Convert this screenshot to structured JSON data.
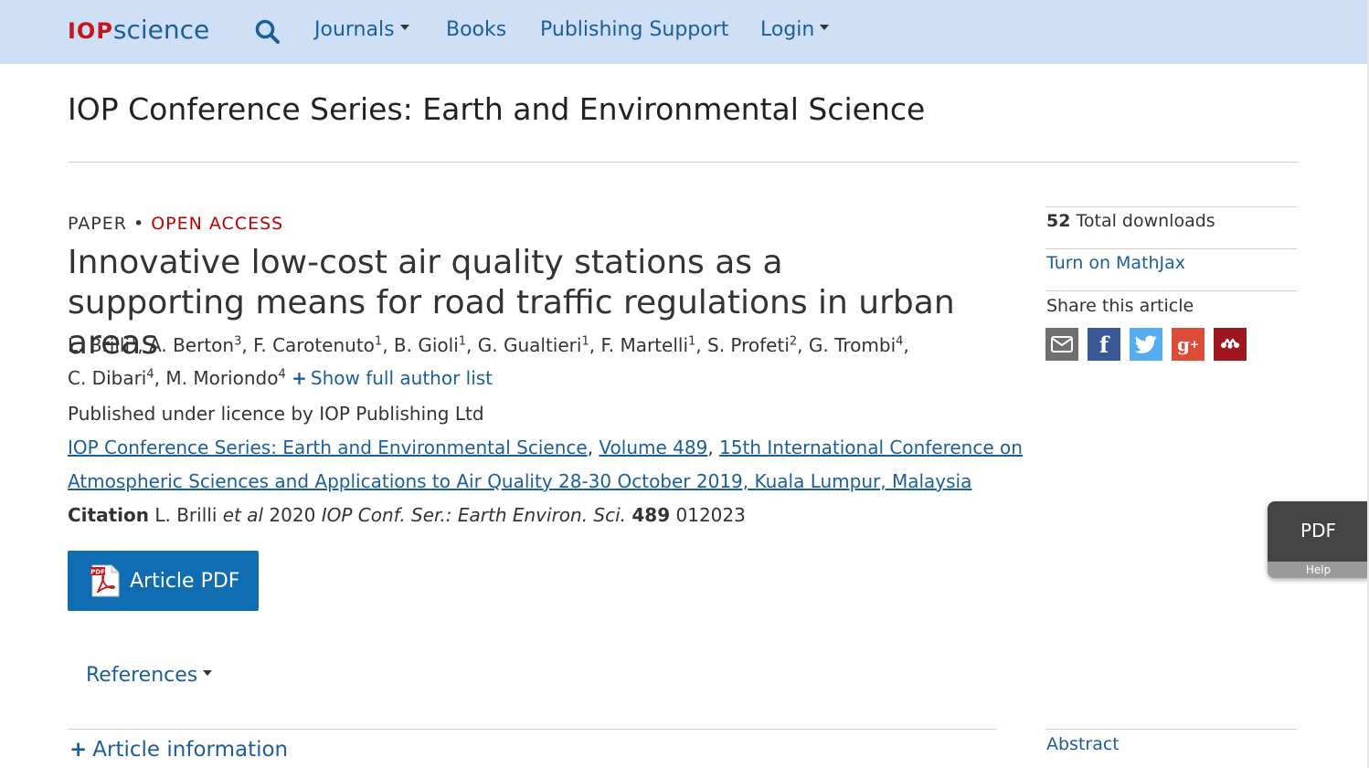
{
  "nav": {
    "logo_iop": "IOP",
    "logo_science": "science",
    "items": [
      {
        "label": "Journals",
        "dropdown": true
      },
      {
        "label": "Books",
        "dropdown": false
      },
      {
        "label": "Publishing Support",
        "dropdown": false
      },
      {
        "label": "Login",
        "dropdown": true
      }
    ],
    "search_icon": "search-icon"
  },
  "journal_title": "IOP Conference Series: Earth and Environmental Science",
  "article": {
    "type": "PAPER",
    "separator": "•",
    "access": "OPEN ACCESS",
    "title": "Innovative low-cost air quality stations as a supporting means for road traffic regulations in urban areas",
    "authors": [
      {
        "name": "L. Brilli",
        "aff": "1"
      },
      {
        "name": "A. Berton",
        "aff": "3"
      },
      {
        "name": "F. Carotenuto",
        "aff": "1"
      },
      {
        "name": "B. Gioli",
        "aff": "1"
      },
      {
        "name": "G. Gualtieri",
        "aff": "1"
      },
      {
        "name": "F. Martelli",
        "aff": "1"
      },
      {
        "name": "S. Profeti",
        "aff": "2"
      },
      {
        "name": "G. Trombi",
        "aff": "4"
      },
      {
        "name": "C. Dibari",
        "aff": "4"
      },
      {
        "name": "M. Moriondo",
        "aff": "4"
      }
    ],
    "show_authors": "Show full author list",
    "licence": "Published under licence by IOP Publishing Ltd",
    "links": {
      "journal": "IOP Conference Series: Earth and Environmental Science",
      "volume": "Volume 489",
      "conference_line1": "15th International Conference on",
      "conference_line2": "Atmospheric Sciences and Applications to Air Quality 28-30 October 2019, Kuala Lumpur, Malaysia"
    },
    "citation": {
      "label": "Citation",
      "author": "L. Brilli",
      "etal": "et al",
      "year": "2020",
      "journal_abbrev": "IOP Conf. Ser.: Earth Environ. Sci.",
      "volume": "489",
      "article_no": "012023"
    },
    "pdf_button": "Article PDF",
    "references": "References",
    "article_information": "Article information"
  },
  "sidebar": {
    "downloads_count": "52",
    "downloads_label": "Total downloads",
    "mathjax": "Turn on MathJax",
    "share_title": "Share this article",
    "share_buttons": [
      {
        "name": "email-icon",
        "color": "#6f6f6f"
      },
      {
        "name": "facebook-icon",
        "color": "#3b5998"
      },
      {
        "name": "twitter-icon",
        "color": "#55acee"
      },
      {
        "name": "google-plus-icon",
        "color": "#dd4b39"
      },
      {
        "name": "mendeley-icon",
        "color": "#9d1620"
      }
    ],
    "abstract": "Abstract"
  },
  "float_panel": {
    "pdf": "PDF",
    "help": "Help"
  }
}
